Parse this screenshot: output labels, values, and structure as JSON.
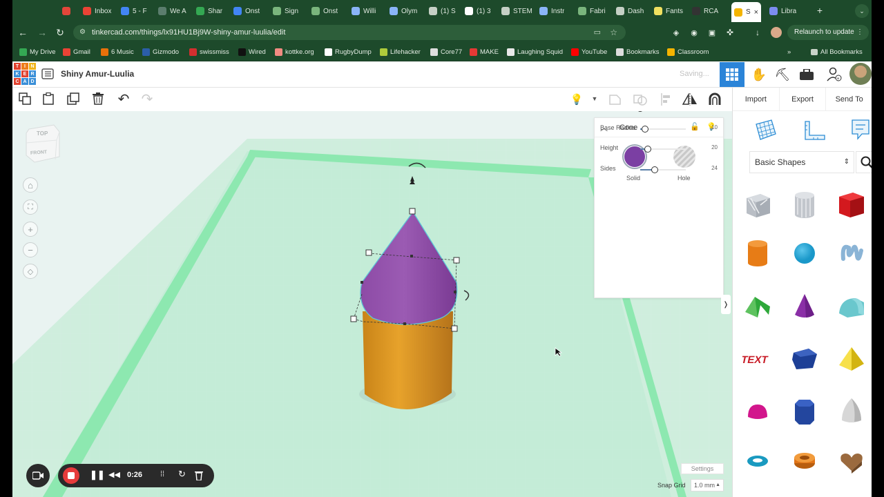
{
  "browser": {
    "tabs": [
      {
        "label": "",
        "color": "#e2463a"
      },
      {
        "label": "Inbox",
        "color": "#ea4335"
      },
      {
        "label": "5 - F",
        "color": "#4285f4"
      },
      {
        "label": "We A",
        "color": "#5b7d6d"
      },
      {
        "label": "Shar",
        "color": "#34a853"
      },
      {
        "label": "Onst",
        "color": "#4285f4"
      },
      {
        "label": "Sign",
        "color": "#7ab57d"
      },
      {
        "label": "Onst",
        "color": "#7ab57d"
      },
      {
        "label": "Willi",
        "color": "#8ab4f8"
      },
      {
        "label": "Olym",
        "color": "#8ab4f8"
      },
      {
        "label": "(1) S",
        "color": "#c5d0c5"
      },
      {
        "label": "(1) 3",
        "color": "#ffffff"
      },
      {
        "label": "STEM",
        "color": "#c5d0c5"
      },
      {
        "label": "Instr",
        "color": "#8ab4f8"
      },
      {
        "label": "Fabri",
        "color": "#7ab57d"
      },
      {
        "label": "Dash",
        "color": "#c5d0c5"
      },
      {
        "label": "Fants",
        "color": "#f0e060"
      },
      {
        "label": "RCA",
        "color": "#333333"
      },
      {
        "label": "S",
        "color": "#f4b400"
      },
      {
        "label": "Libra",
        "color": "#7c8cf0"
      }
    ],
    "url": "tinkercad.com/things/lx91HU1Bj9W-shiny-amur-luulia/edit",
    "relaunch_label": "Relaunch to update",
    "bookmarks": [
      {
        "label": "My Drive",
        "color": "#34a853"
      },
      {
        "label": "Gmail",
        "color": "#ea4335"
      },
      {
        "label": "6 Music",
        "color": "#e8710a"
      },
      {
        "label": "Gizmodo",
        "color": "#2b5ea8"
      },
      {
        "label": "swissmiss",
        "color": "#d32f2f"
      },
      {
        "label": "Wired",
        "color": "#111111"
      },
      {
        "label": "kottke.org",
        "color": "#f28b82"
      },
      {
        "label": "RugbyDump",
        "color": "#ffffff"
      },
      {
        "label": "Lifehacker",
        "color": "#aecb3b"
      },
      {
        "label": "Core77",
        "color": "#dddddd"
      },
      {
        "label": "MAKE",
        "color": "#e53935"
      },
      {
        "label": "Laughing Squid",
        "color": "#e9e9e9"
      },
      {
        "label": "YouTube",
        "color": "#ff0000"
      },
      {
        "label": "Bookmarks",
        "color": "#dddddd"
      },
      {
        "label": "Classroom",
        "color": "#f4b400"
      }
    ],
    "all_bookmarks_label": "All Bookmarks"
  },
  "app": {
    "logo_letters": [
      "T",
      "I",
      "N",
      "K",
      "E",
      "R",
      "C",
      "A",
      "D"
    ],
    "project_name": "Shiny Amur-Luulia",
    "saving_text": "Saving...",
    "actions": {
      "import": "Import",
      "export": "Export",
      "send_to": "Send To"
    }
  },
  "viewcube": {
    "top": "TOP",
    "front": "FRONT"
  },
  "inspector": {
    "title": "Cone",
    "solid_label": "Solid",
    "hole_label": "Hole",
    "solid_color": "#7b3fa3",
    "properties": [
      {
        "label": "Top Radius",
        "value": "0",
        "fraction": 0.0
      },
      {
        "label": "Base Radius",
        "value": "10",
        "fraction": 0.1
      },
      {
        "label": "Height",
        "value": "20",
        "fraction": 0.16
      },
      {
        "label": "Sides",
        "value": "24",
        "fraction": 0.32
      }
    ]
  },
  "library": {
    "category": "Basic Shapes",
    "shapes": [
      {
        "name": "box-hole-shape",
        "color": "#b9bec5"
      },
      {
        "name": "cylinder-hole-shape",
        "color": "#c2c6cc"
      },
      {
        "name": "box-shape",
        "color": "#d3191e"
      },
      {
        "name": "cylinder-shape",
        "color": "#e77c16"
      },
      {
        "name": "sphere-shape",
        "color": "#1a98c9"
      },
      {
        "name": "scribble-shape",
        "color": "#8ab4d6"
      },
      {
        "name": "roof-shape",
        "color": "#2ea83a"
      },
      {
        "name": "cone-shape",
        "color": "#8a2fa6"
      },
      {
        "name": "round-roof-shape",
        "color": "#6ac7cd"
      },
      {
        "name": "text-shape",
        "color": "#c81b26"
      },
      {
        "name": "prism-shape",
        "color": "#1d3f96"
      },
      {
        "name": "pyramid-shape",
        "color": "#f2d41a"
      },
      {
        "name": "half-sphere-shape",
        "color": "#d2168c"
      },
      {
        "name": "polygon-shape",
        "color": "#23469e"
      },
      {
        "name": "paraboloid-shape",
        "color": "#d7d7d7"
      },
      {
        "name": "torus-shape",
        "color": "#1a9ac0"
      },
      {
        "name": "tube-shape",
        "color": "#e17417"
      },
      {
        "name": "heart-shape",
        "color": "#9b6a3e"
      }
    ]
  },
  "footer": {
    "settings_label": "Settings",
    "snap_grid_label": "Snap Grid",
    "snap_grid_value": "1.0 mm"
  },
  "recorder": {
    "time": "0:26"
  }
}
